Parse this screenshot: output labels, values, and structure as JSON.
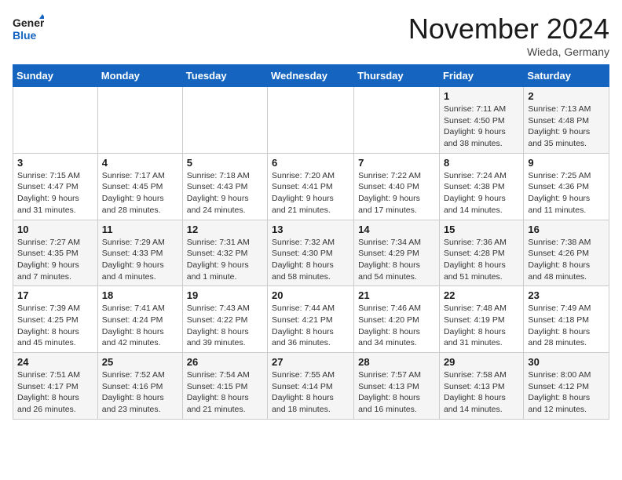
{
  "header": {
    "logo_general": "General",
    "logo_blue": "Blue",
    "month": "November 2024",
    "location": "Wieda, Germany"
  },
  "calendar": {
    "days_of_week": [
      "Sunday",
      "Monday",
      "Tuesday",
      "Wednesday",
      "Thursday",
      "Friday",
      "Saturday"
    ],
    "weeks": [
      [
        {
          "day": "",
          "info": ""
        },
        {
          "day": "",
          "info": ""
        },
        {
          "day": "",
          "info": ""
        },
        {
          "day": "",
          "info": ""
        },
        {
          "day": "",
          "info": ""
        },
        {
          "day": "1",
          "info": "Sunrise: 7:11 AM\nSunset: 4:50 PM\nDaylight: 9 hours\nand 38 minutes."
        },
        {
          "day": "2",
          "info": "Sunrise: 7:13 AM\nSunset: 4:48 PM\nDaylight: 9 hours\nand 35 minutes."
        }
      ],
      [
        {
          "day": "3",
          "info": "Sunrise: 7:15 AM\nSunset: 4:47 PM\nDaylight: 9 hours\nand 31 minutes."
        },
        {
          "day": "4",
          "info": "Sunrise: 7:17 AM\nSunset: 4:45 PM\nDaylight: 9 hours\nand 28 minutes."
        },
        {
          "day": "5",
          "info": "Sunrise: 7:18 AM\nSunset: 4:43 PM\nDaylight: 9 hours\nand 24 minutes."
        },
        {
          "day": "6",
          "info": "Sunrise: 7:20 AM\nSunset: 4:41 PM\nDaylight: 9 hours\nand 21 minutes."
        },
        {
          "day": "7",
          "info": "Sunrise: 7:22 AM\nSunset: 4:40 PM\nDaylight: 9 hours\nand 17 minutes."
        },
        {
          "day": "8",
          "info": "Sunrise: 7:24 AM\nSunset: 4:38 PM\nDaylight: 9 hours\nand 14 minutes."
        },
        {
          "day": "9",
          "info": "Sunrise: 7:25 AM\nSunset: 4:36 PM\nDaylight: 9 hours\nand 11 minutes."
        }
      ],
      [
        {
          "day": "10",
          "info": "Sunrise: 7:27 AM\nSunset: 4:35 PM\nDaylight: 9 hours\nand 7 minutes."
        },
        {
          "day": "11",
          "info": "Sunrise: 7:29 AM\nSunset: 4:33 PM\nDaylight: 9 hours\nand 4 minutes."
        },
        {
          "day": "12",
          "info": "Sunrise: 7:31 AM\nSunset: 4:32 PM\nDaylight: 9 hours\nand 1 minute."
        },
        {
          "day": "13",
          "info": "Sunrise: 7:32 AM\nSunset: 4:30 PM\nDaylight: 8 hours\nand 58 minutes."
        },
        {
          "day": "14",
          "info": "Sunrise: 7:34 AM\nSunset: 4:29 PM\nDaylight: 8 hours\nand 54 minutes."
        },
        {
          "day": "15",
          "info": "Sunrise: 7:36 AM\nSunset: 4:28 PM\nDaylight: 8 hours\nand 51 minutes."
        },
        {
          "day": "16",
          "info": "Sunrise: 7:38 AM\nSunset: 4:26 PM\nDaylight: 8 hours\nand 48 minutes."
        }
      ],
      [
        {
          "day": "17",
          "info": "Sunrise: 7:39 AM\nSunset: 4:25 PM\nDaylight: 8 hours\nand 45 minutes."
        },
        {
          "day": "18",
          "info": "Sunrise: 7:41 AM\nSunset: 4:24 PM\nDaylight: 8 hours\nand 42 minutes."
        },
        {
          "day": "19",
          "info": "Sunrise: 7:43 AM\nSunset: 4:22 PM\nDaylight: 8 hours\nand 39 minutes."
        },
        {
          "day": "20",
          "info": "Sunrise: 7:44 AM\nSunset: 4:21 PM\nDaylight: 8 hours\nand 36 minutes."
        },
        {
          "day": "21",
          "info": "Sunrise: 7:46 AM\nSunset: 4:20 PM\nDaylight: 8 hours\nand 34 minutes."
        },
        {
          "day": "22",
          "info": "Sunrise: 7:48 AM\nSunset: 4:19 PM\nDaylight: 8 hours\nand 31 minutes."
        },
        {
          "day": "23",
          "info": "Sunrise: 7:49 AM\nSunset: 4:18 PM\nDaylight: 8 hours\nand 28 minutes."
        }
      ],
      [
        {
          "day": "24",
          "info": "Sunrise: 7:51 AM\nSunset: 4:17 PM\nDaylight: 8 hours\nand 26 minutes."
        },
        {
          "day": "25",
          "info": "Sunrise: 7:52 AM\nSunset: 4:16 PM\nDaylight: 8 hours\nand 23 minutes."
        },
        {
          "day": "26",
          "info": "Sunrise: 7:54 AM\nSunset: 4:15 PM\nDaylight: 8 hours\nand 21 minutes."
        },
        {
          "day": "27",
          "info": "Sunrise: 7:55 AM\nSunset: 4:14 PM\nDaylight: 8 hours\nand 18 minutes."
        },
        {
          "day": "28",
          "info": "Sunrise: 7:57 AM\nSunset: 4:13 PM\nDaylight: 8 hours\nand 16 minutes."
        },
        {
          "day": "29",
          "info": "Sunrise: 7:58 AM\nSunset: 4:13 PM\nDaylight: 8 hours\nand 14 minutes."
        },
        {
          "day": "30",
          "info": "Sunrise: 8:00 AM\nSunset: 4:12 PM\nDaylight: 8 hours\nand 12 minutes."
        }
      ]
    ]
  }
}
